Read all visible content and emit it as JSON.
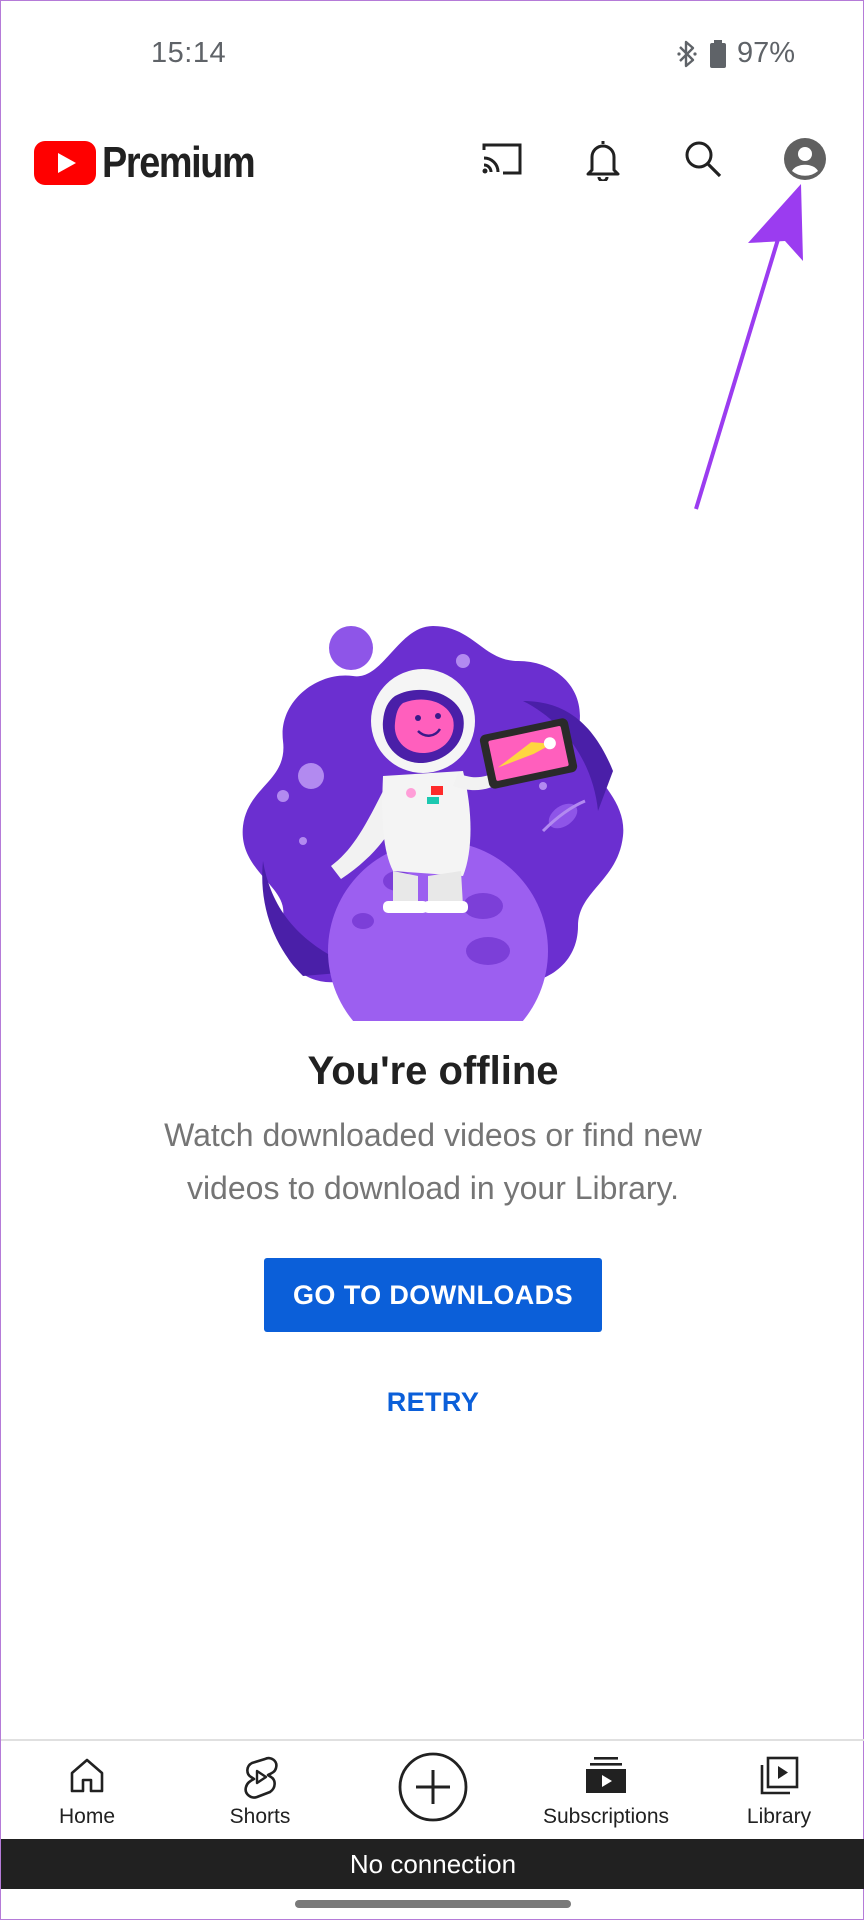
{
  "status_bar": {
    "time": "15:14",
    "battery": "97%",
    "icons": [
      "bluetooth-icon",
      "battery-icon"
    ]
  },
  "app_bar": {
    "logo_text": "Premium",
    "brand_color": "#ff0000",
    "actions": [
      "cast-icon",
      "bell-icon",
      "search-icon",
      "account-icon"
    ]
  },
  "annotation": {
    "arrow_color": "#9b3cf0"
  },
  "offline": {
    "title": "You're offline",
    "message": "Watch downloaded videos or find new videos to download in your Library.",
    "primary_button": "GO TO DOWNLOADS",
    "secondary_button": "RETRY",
    "accent_color": "#0b5fd9"
  },
  "bottom_nav": {
    "items": [
      {
        "label": "Home",
        "icon": "home-icon"
      },
      {
        "label": "",
        "icon": "create-icon"
      },
      {
        "label": "Shorts",
        "icon": "shorts-icon"
      },
      {
        "label": "Subscriptions",
        "icon": "subscriptions-icon"
      },
      {
        "label": "Library",
        "icon": "library-icon"
      }
    ]
  },
  "connection_banner": "No connection"
}
